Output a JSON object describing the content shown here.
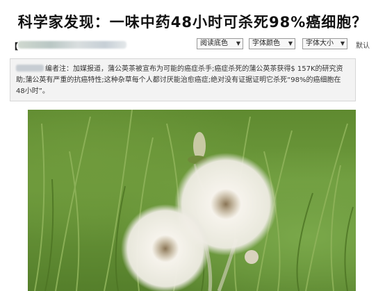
{
  "article": {
    "title": "科学家发现：一味中药48小时可杀死98%癌细胞？",
    "source_prefix": "【"
  },
  "toolbar": {
    "bg_color_label": "阅读底色",
    "font_color_label": "字体颜色",
    "font_size_label": "字体大小",
    "reset_label": "默认",
    "arrow": "▼"
  },
  "editor_note": {
    "text": "编者注：加媒报道，蒲公英茶被宣布为可能的癌症杀手;癌症杀死的蒲公英茶获得$ 157K的研究资助;蒲公英有严重的抗癌特性;这种杂草每个人都讨厌能治愈癌症;绝对没有证据证明它杀死“98%的癌细胞在48小时”。"
  },
  "image": {
    "subject": "dandelion-seed-heads-in-grass",
    "colors": {
      "grass": "#6e9b3d",
      "seed": "#f4f1ea",
      "stem": "#9fae7e"
    }
  }
}
